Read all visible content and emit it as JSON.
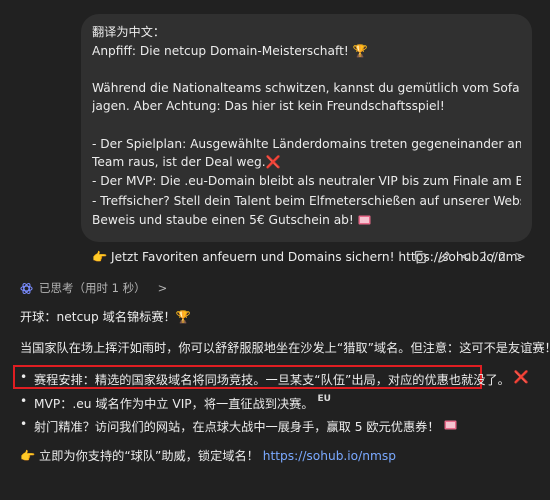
{
  "user_message": {
    "lines": [
      "翻译为中文：",
      "Anpfiff: Die netcup Domain-Meisterschaft! 🏆",
      "",
      "Während die Nationalteams schwitzen, kannst du gemütlich vom Sofa aus Domains",
      "jagen. Aber Achtung: Das hier ist kein Freundschaftsspiel!",
      "",
      "- Der Spielplan: Ausgewählte Länderdomains treten gegeneinander an. Fliegt das",
      "Team raus, ist der Deal weg.",
      "- Der MVP: Die .eu-Domain bleibt als neutraler VIP bis zum Finale am Ball.",
      "- Treffsicher? Stell dein Talent beim Elfmeterschießen auf unserer Website unter",
      "Beweis und staube einen 5€ Gutschein ab! ",
      "",
      "👉 Jetzt Favoriten anfeuern und Domains sichern! https://sohub.io/nmsp"
    ],
    "cross": "❌",
    "eu_badge": "EU"
  },
  "controls": {
    "pager": "2 / 2",
    "prev_arrow": "<",
    "next_arrow": ">"
  },
  "thinking": {
    "label": "已思考（用时 1 秒）",
    "chevron": ">"
  },
  "response": {
    "p1": "开球：netcup 域名锦标赛！🏆",
    "p2": "当国家队在场上挥汗如雨时，你可以舒舒服服地坐在沙发上“猎取”域名。但注意：这可不是友谊赛！",
    "bullets": [
      "赛程安排：精选的国家级域名将同场竞技。一旦某支“队伍”出局，对应的优惠也就没了。",
      "MVP：.eu 域名作为中立 VIP，将一直征战到决赛。",
      "射门精准？访问我们的网站，在点球大战中一展身手，赢取 5 欧元优惠券！"
    ],
    "bullet_char": "•",
    "cta_text": "👉 立即为你支持的“球队”助威，锁定域名！",
    "cta_link": "https://sohub.io/nmsp"
  },
  "colors": {
    "background": "#212121",
    "bubble": "#303030",
    "highlight_border": "#e01e22",
    "link": "#7aa9ff",
    "cross": "#f23f5a"
  }
}
